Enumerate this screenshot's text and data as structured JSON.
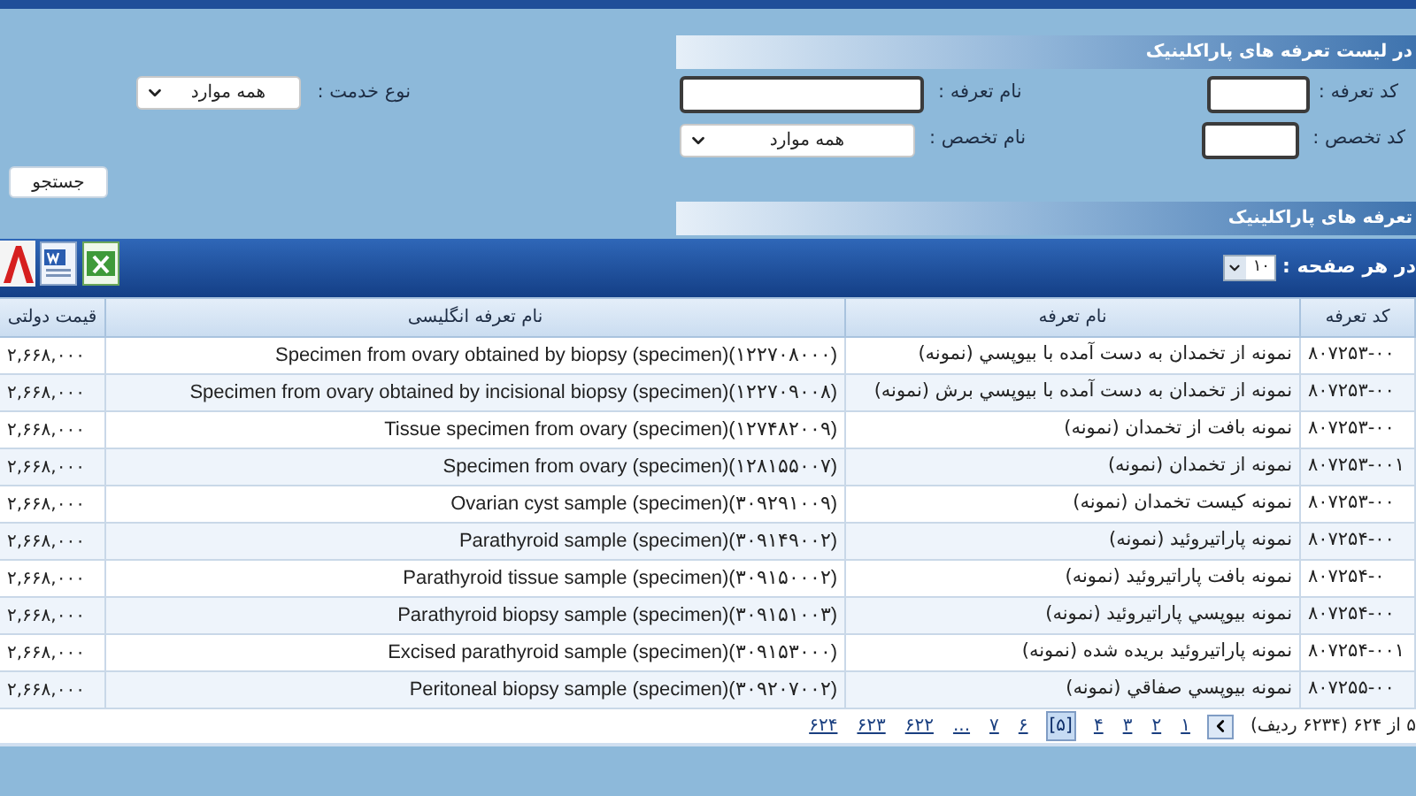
{
  "header": {
    "title": "در لیست تعرفه های پاراکلینیک"
  },
  "filters": [
    {
      "label": "کد تعرفه :",
      "kind": "input"
    },
    {
      "label": "نام تعرفه :",
      "kind": "input"
    },
    {
      "label": "نوع خدمت :",
      "kind": "select",
      "value": "همه موارد"
    },
    {
      "label": "کد تخصص :",
      "kind": "input"
    },
    {
      "label": "نام تخصص :",
      "kind": "select",
      "value": "همه موارد"
    }
  ],
  "search_button": "جستجو",
  "results_title": "تعرفه های پاراکلینیک",
  "toolbar": {
    "page_size_label": "در هر صفحه :",
    "page_size": "۱۰"
  },
  "table": {
    "columns": [
      "کد تعرفه",
      "نام تعرفه",
      "نام تعرفه انگلیسی",
      "قیمت دولتی"
    ],
    "rows": [
      [
        "۸۰۷۲۵۳-۰۰",
        "نمونه از تخمدان به دست آمده با بیوپسي (نمونه)",
        "Specimen from ovary obtained by biopsy (specimen)(۱۲۲۷۰۸۰۰۰)",
        "۲,۶۶۸,۰۰۰"
      ],
      [
        "۸۰۷۲۵۳-۰۰",
        "نمونه از تخمدان به دست آمده با بیوپسي برش (نمونه)",
        "Specimen from ovary obtained by incisional biopsy (specimen)(۱۲۲۷۰۹۰۰۸)",
        "۲,۶۶۸,۰۰۰"
      ],
      [
        "۸۰۷۲۵۳-۰۰",
        "نمونه بافت از تخمدان (نمونه)",
        "Tissue specimen from ovary (specimen)(۱۲۷۴۸۲۰۰۹)",
        "۲,۶۶۸,۰۰۰"
      ],
      [
        "۸۰۷۲۵۳-۰۰۱",
        "نمونه از تخمدان (نمونه)",
        "Specimen from ovary (specimen)(۱۲۸۱۵۵۰۰۷)",
        "۲,۶۶۸,۰۰۰"
      ],
      [
        "۸۰۷۲۵۳-۰۰",
        "نمونه کیست تخمدان (نمونه)",
        "Ovarian cyst sample (specimen)(۳۰۹۲۹۱۰۰۹)",
        "۲,۶۶۸,۰۰۰"
      ],
      [
        "۸۰۷۲۵۴-۰۰",
        "نمونه پاراتیروئید (نمونه)",
        "Parathyroid sample (specimen)(۳۰۹۱۴۹۰۰۲)",
        "۲,۶۶۸,۰۰۰"
      ],
      [
        "۸۰۷۲۵۴-۰",
        "نمونه بافت پاراتیروئید (نمونه)",
        "Parathyroid tissue sample (specimen)(۳۰۹۱۵۰۰۰۲)",
        "۲,۶۶۸,۰۰۰"
      ],
      [
        "۸۰۷۲۵۴-۰۰",
        "نمونه بیوپسي پاراتیروئید (نمونه)",
        "Parathyroid biopsy sample (specimen)(۳۰۹۱۵۱۰۰۳)",
        "۲,۶۶۸,۰۰۰"
      ],
      [
        "۸۰۷۲۵۴-۰۰۱",
        "نمونه پاراتیروئید بریده شده (نمونه)",
        "Excised parathyroid sample (specimen)(۳۰۹۱۵۳۰۰۰)",
        "۲,۶۶۸,۰۰۰"
      ],
      [
        "۸۰۷۲۵۵-۰۰",
        "نمونه بیوپسي صفاقي (نمونه)",
        "Peritoneal biopsy sample (specimen)(۳۰۹۲۰۷۰۰۲)",
        "۲,۶۶۸,۰۰۰"
      ]
    ]
  },
  "pagination": {
    "summary": "۵ از ۶۲۴ (۶۲۳۴ ردیف)",
    "pages": [
      {
        "label": "۱",
        "selected": false
      },
      {
        "label": "۲",
        "selected": false
      },
      {
        "label": "۳",
        "selected": false
      },
      {
        "label": "۴",
        "selected": false
      },
      {
        "label": "[۵]",
        "selected": true
      },
      {
        "label": "۶",
        "selected": false
      },
      {
        "label": "۷",
        "selected": false
      },
      {
        "label": "...",
        "selected": false
      },
      {
        "label": "۶۲۲",
        "selected": false
      },
      {
        "label": "۶۲۳",
        "selected": false
      },
      {
        "label": "۶۲۴",
        "selected": false
      }
    ]
  }
}
